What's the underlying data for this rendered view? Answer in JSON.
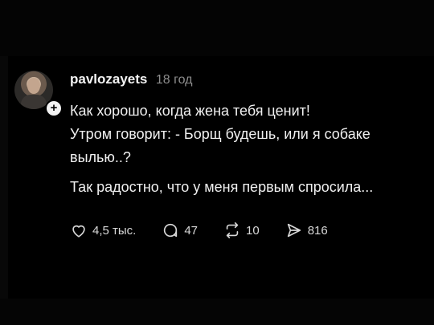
{
  "post": {
    "username": "pavlozayets",
    "time": "18 год",
    "lines": [
      "Как хорошо, когда жена тебя ценит!",
      "Утром говорит: - Борщ будешь, или я собаке",
      "вылью..?",
      "Так радостно, что у меня первым спросила..."
    ],
    "follow_symbol": "+"
  },
  "actions": {
    "likes": "4,5 тыс.",
    "comments": "47",
    "reposts": "10",
    "shares": "816"
  },
  "icons": {
    "like": "heart-icon",
    "comment": "comment-bubble-icon",
    "repost": "repost-arrows-icon",
    "share": "send-icon"
  }
}
